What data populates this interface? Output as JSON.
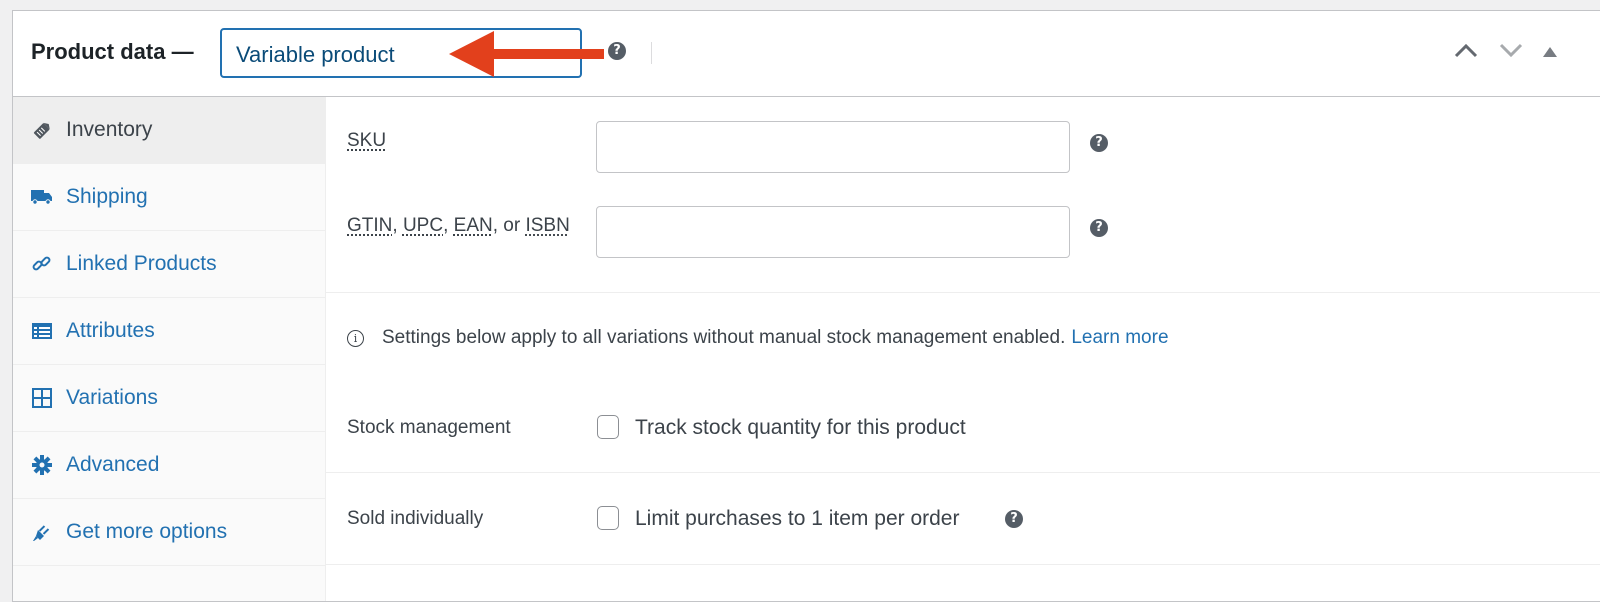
{
  "header": {
    "title": "Product data —",
    "product_type": "Variable product",
    "help_icon": "help-icon",
    "controls": [
      "move-up-icon",
      "move-down-icon",
      "toggle-panel-icon"
    ]
  },
  "annotation": {
    "arrow_color": "#e2401c",
    "arrow_direction": "left"
  },
  "tabs": [
    {
      "label": "Inventory",
      "icon": "tag-icon",
      "active": true
    },
    {
      "label": "Shipping",
      "icon": "truck-icon",
      "active": false
    },
    {
      "label": "Linked Products",
      "icon": "link-icon",
      "active": false
    },
    {
      "label": "Attributes",
      "icon": "list-icon",
      "active": false
    },
    {
      "label": "Variations",
      "icon": "grid-icon",
      "active": false
    },
    {
      "label": "Advanced",
      "icon": "gear-icon",
      "active": false
    },
    {
      "label": "Get more options",
      "icon": "plugin-icon",
      "active": false
    }
  ],
  "inventory": {
    "sku": {
      "label": "SKU",
      "value": ""
    },
    "gtin": {
      "label_parts": [
        "GTIN",
        ", ",
        "UPC",
        ", ",
        "EAN",
        ", or ",
        "ISBN"
      ],
      "value": ""
    },
    "notice": {
      "text": "Settings below apply to all variations without manual stock management enabled.",
      "link": "Learn more"
    },
    "stock_management": {
      "label": "Stock management",
      "checkbox_label": "Track stock quantity for this product",
      "checked": false
    },
    "sold_individually": {
      "label": "Sold individually",
      "checkbox_label": "Limit purchases to 1 item per order",
      "checked": false
    }
  },
  "colors": {
    "accent": "#2271b1",
    "tab_active_bg": "#eeeeee",
    "text": "#3c434a"
  }
}
